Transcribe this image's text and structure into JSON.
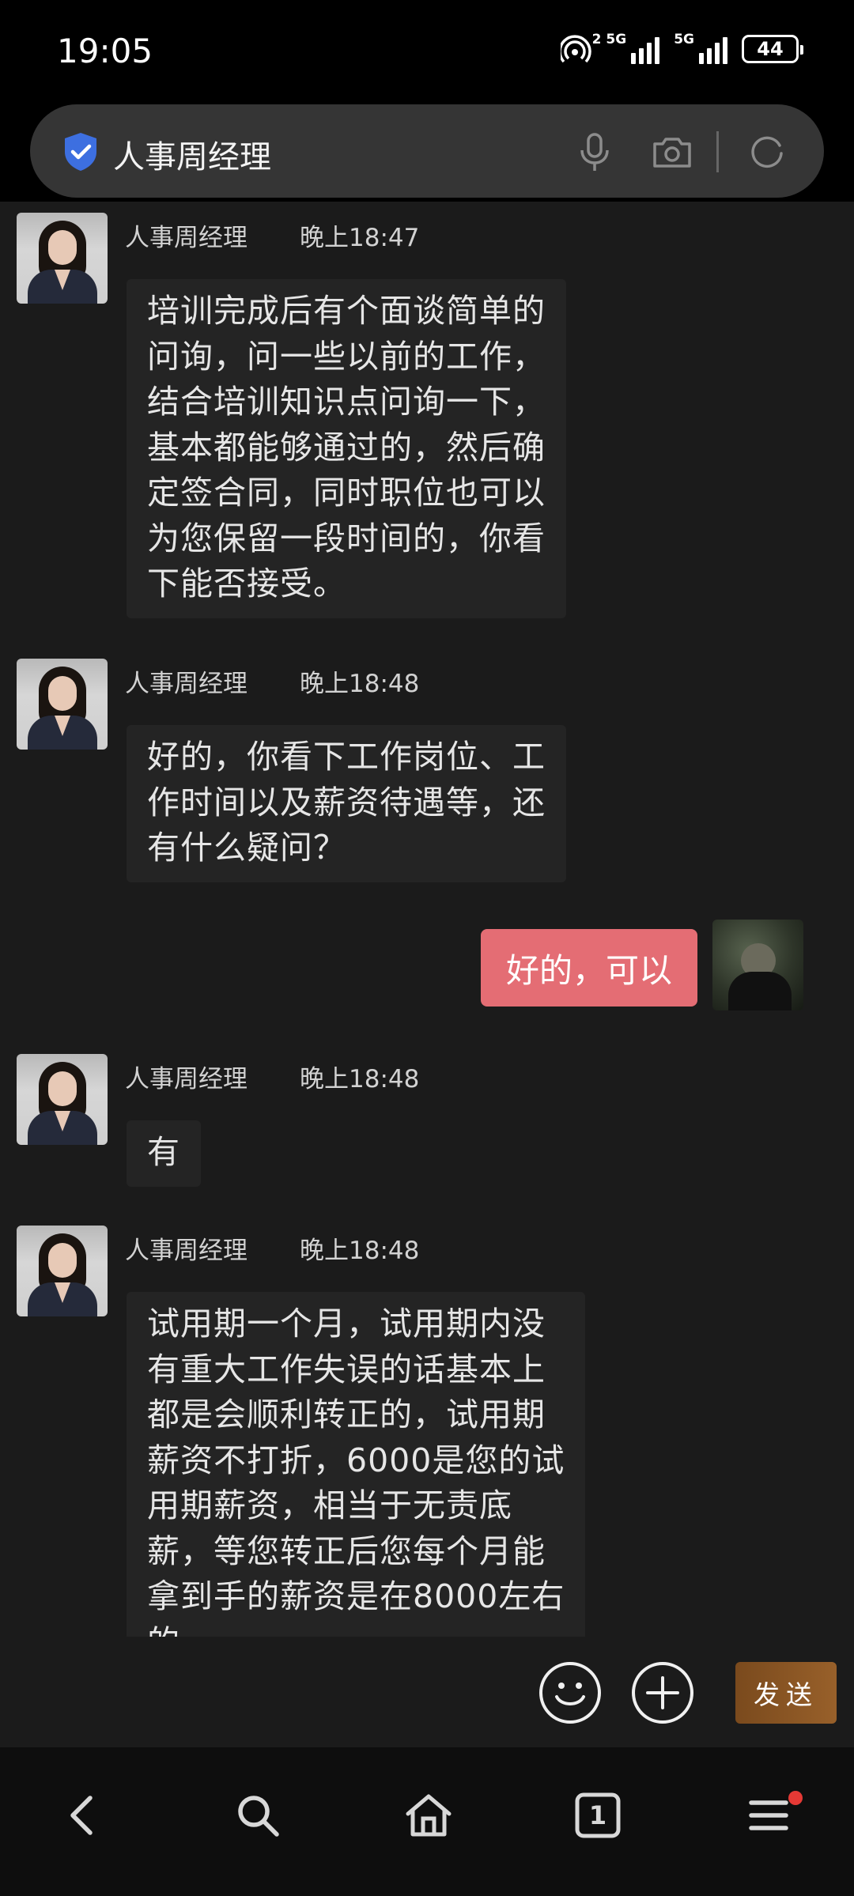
{
  "status": {
    "time": "19:05",
    "net1": "5G",
    "net2": "5G",
    "hotspot_num": "2",
    "battery": "44"
  },
  "header": {
    "title": "人事周经理"
  },
  "messages": [
    {
      "sender": "人事周经理",
      "time": "晚上18:47",
      "lines": [
        "培训完成后有个面谈简单的",
        "问询，问一些以前的工作，",
        "结合培训知识点问询一下，",
        "基本都能够通过的，然后确",
        "定签合同，同时职位也可以",
        "为您保留一段时间的，你看",
        "下能否接受。"
      ]
    },
    {
      "sender": "人事周经理",
      "time": "晚上18:48",
      "lines": [
        "好的，你看下工作岗位、工",
        "作时间以及薪资待遇等，还",
        "有什么疑问？"
      ]
    },
    {
      "self": true,
      "text": "好的，可以"
    },
    {
      "sender": "人事周经理",
      "time": "晚上18:48",
      "lines": [
        "有"
      ]
    },
    {
      "sender": "人事周经理",
      "time": "晚上18:48",
      "lines": [
        "试用期一个月，试用期内没",
        "有重大工作失误的话基本上",
        "都是会顺利转正的，试用期",
        "薪资不打折，6000是您的试",
        "用期薪资，相当于无责底",
        "薪，等您转正后您每个月能",
        "拿到手的薪资是在8000左右",
        "的"
      ]
    }
  ],
  "input": {
    "send_label": "发送"
  },
  "nav": {
    "tabs_count": "1"
  },
  "colors": {
    "self_bubble": "#e46d74",
    "send_button": "#8a5524",
    "shield": "#3d6fe0"
  }
}
